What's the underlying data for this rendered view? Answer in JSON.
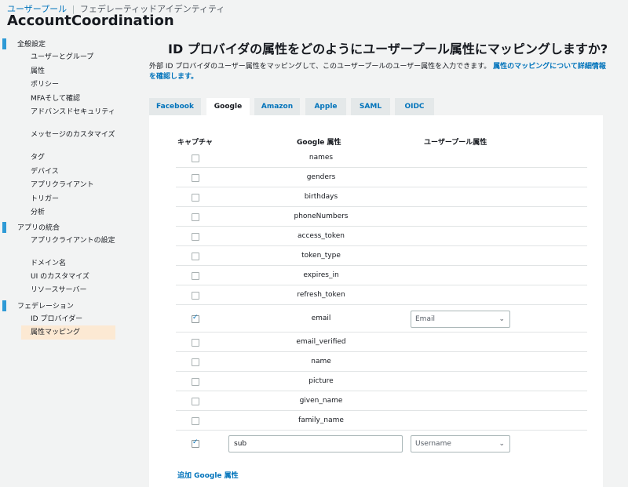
{
  "header": {
    "breadcrumb_link": "ユーザープール",
    "breadcrumb_separator": "|",
    "breadcrumb_current": "フェデレーティッドアイデンティティ",
    "title": "AccountCoordination"
  },
  "sidebar": {
    "sections": [
      {
        "label": "全般設定",
        "items": [
          "ユーザーとグループ",
          "属性",
          "ポリシー",
          "MFAそして確認",
          "アドバンスドセキュリティ",
          "メッセージのカスタマイズ",
          "タグ",
          "デバイス",
          "アプリクライアント",
          "トリガー",
          "分析"
        ]
      },
      {
        "label": "アプリの統合",
        "items": [
          "アプリクライアントの設定",
          "ドメイン名",
          "UI のカスタマイズ",
          "リソースサーバー"
        ]
      },
      {
        "label": "フェデレーション",
        "items": [
          "ID プロバイダー",
          "属性マッピング"
        ]
      }
    ],
    "active_item": "属性マッピング",
    "accent_color": "#2e9ad6"
  },
  "main": {
    "title": "ID プロバイダの属性をどのようにユーザープール属性にマッピングしますか?",
    "description": "外部 ID プロバイダのユーザー属性をマッピングして、このユーザープールのユーザー属性を入力できます。",
    "description_link": "属性のマッピングについて詳細情報を確認します。",
    "tabs": [
      "Facebook",
      "Google",
      "Amazon",
      "Apple",
      "SAML",
      "OIDC"
    ],
    "active_tab": "Google",
    "columns": {
      "capture": "キャプチャ",
      "provider_attr": "Google 属性",
      "pool_attr": "ユーザープール属性"
    },
    "rows": [
      {
        "attr": "names",
        "checked": false
      },
      {
        "attr": "genders",
        "checked": false
      },
      {
        "attr": "birthdays",
        "checked": false
      },
      {
        "attr": "phoneNumbers",
        "checked": false
      },
      {
        "attr": "access_token",
        "checked": false
      },
      {
        "attr": "token_type",
        "checked": false
      },
      {
        "attr": "expires_in",
        "checked": false
      },
      {
        "attr": "refresh_token",
        "checked": false
      },
      {
        "attr": "email",
        "checked": true,
        "pool_attr": "Email"
      },
      {
        "attr": "email_verified",
        "checked": false
      },
      {
        "attr": "name",
        "checked": false
      },
      {
        "attr": "picture",
        "checked": false
      },
      {
        "attr": "given_name",
        "checked": false
      },
      {
        "attr": "family_name",
        "checked": false
      }
    ],
    "custom_row": {
      "checked": true,
      "input_value": "sub",
      "pool_attr": "Username"
    },
    "add_link": "追加 Google 属性"
  }
}
